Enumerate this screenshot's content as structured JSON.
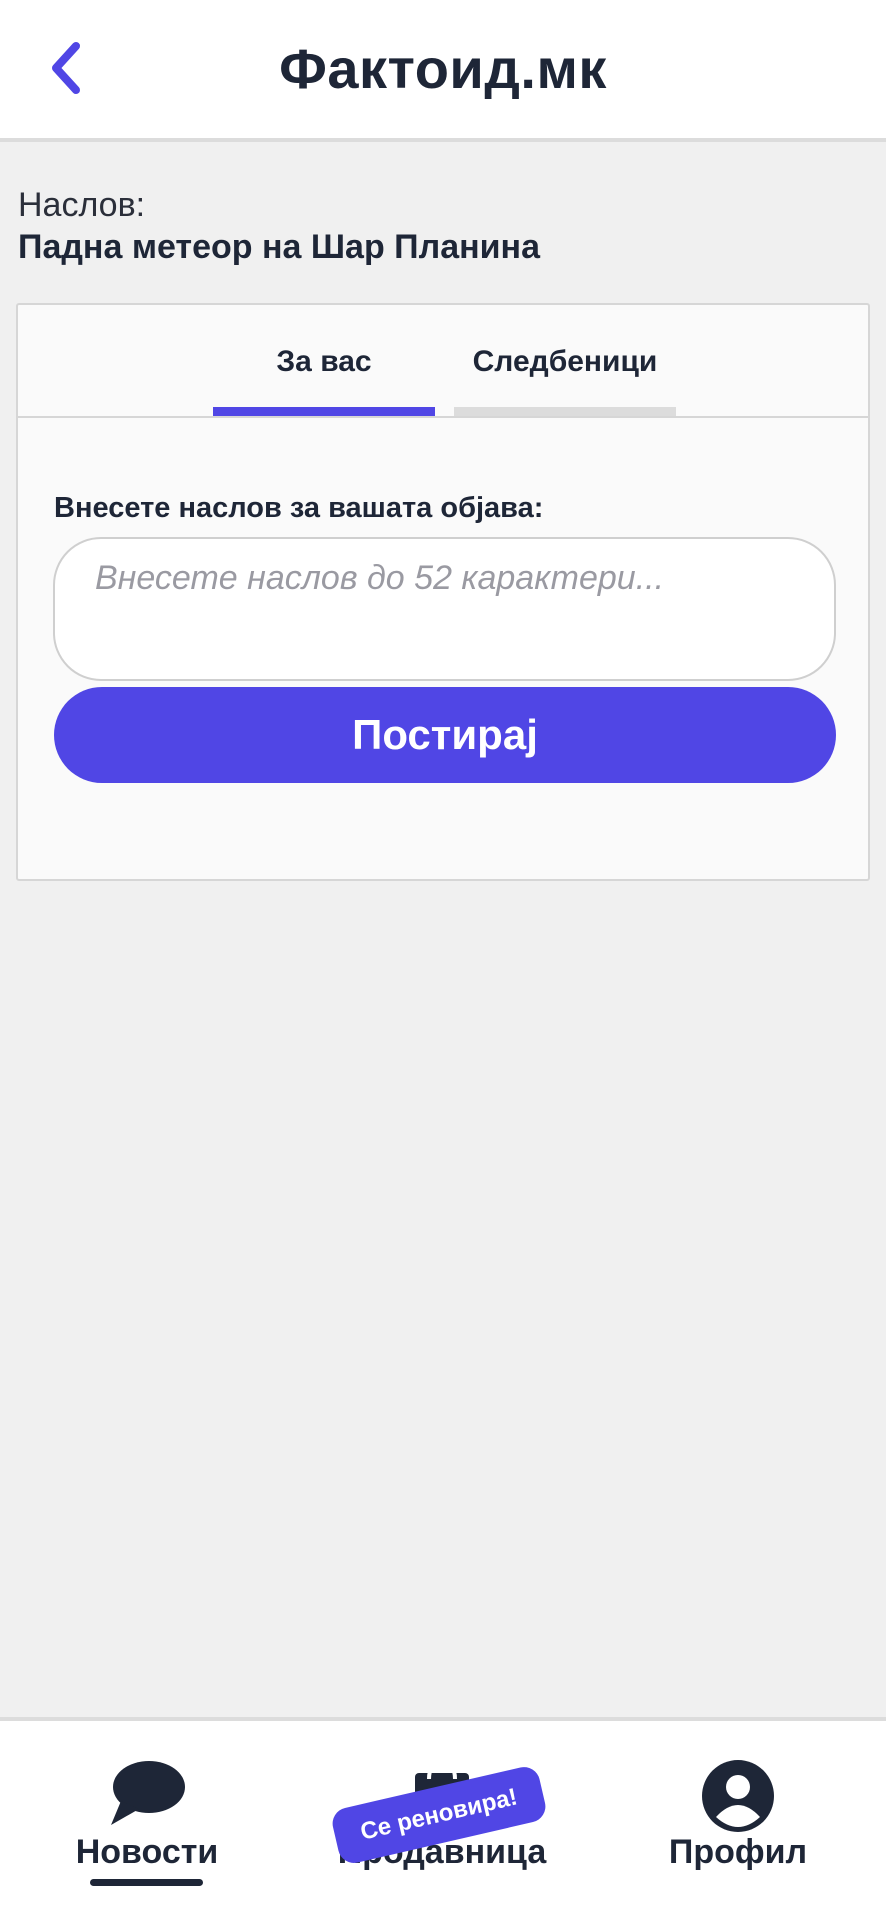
{
  "header": {
    "title": "Фактоид.мк",
    "back_icon": "chevron-left-icon"
  },
  "article": {
    "label": "Наслов:",
    "title": "Падна метеор на Шар Планина"
  },
  "tabs": [
    {
      "label": "За вас",
      "active": true
    },
    {
      "label": "Следбеници",
      "active": false
    }
  ],
  "form": {
    "prompt": "Внесете наслов за вашата објава:",
    "input_value": "",
    "input_placeholder": "Внесете наслов до 52 карактери...",
    "submit_label": "Постирај"
  },
  "bottom_nav": {
    "items": [
      {
        "label": "Новости",
        "icon": "chat-bubble-icon",
        "active": true
      },
      {
        "label": "Продавница",
        "icon": "shopping-bag-icon",
        "active": false
      },
      {
        "label": "Профил",
        "icon": "user-circle-icon",
        "active": false
      }
    ],
    "badge": "Се реновира!"
  },
  "colors": {
    "accent": "#5046e5",
    "text": "#1e2637",
    "background": "#f0f0f0"
  }
}
